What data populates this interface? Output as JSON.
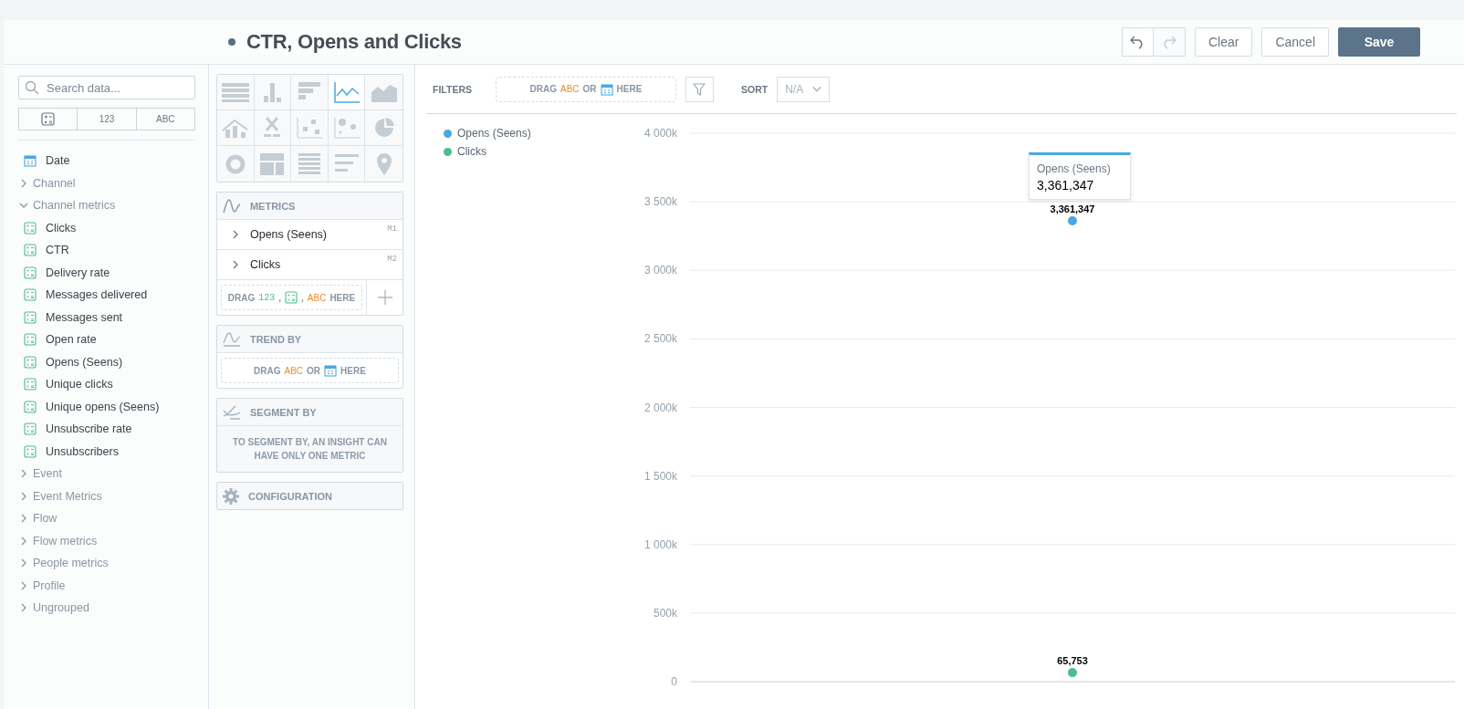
{
  "header": {
    "title": "CTR, Opens and Clicks",
    "undo": {
      "disabled": false
    },
    "redo": {
      "disabled": true
    },
    "buttons": [
      {
        "label": "Clear",
        "kind": "secondary"
      },
      {
        "label": "Cancel",
        "kind": "secondary"
      },
      {
        "label": "Save",
        "kind": "primary"
      }
    ]
  },
  "sidebar": {
    "search": {
      "placeholder": "Search data..."
    },
    "type_filters": [
      {
        "kind": "icon"
      },
      {
        "kind": "text",
        "label": "123"
      },
      {
        "kind": "text",
        "label": "ABC"
      }
    ],
    "items": [
      {
        "kind": "date",
        "label": "Date"
      },
      {
        "kind": "group",
        "label": "Channel",
        "expanded": false
      },
      {
        "kind": "group",
        "label": "Channel metrics",
        "expanded": true,
        "children": [
          {
            "kind": "metric",
            "label": "Clicks"
          },
          {
            "kind": "metric",
            "label": "CTR"
          },
          {
            "kind": "metric",
            "label": "Delivery rate"
          },
          {
            "kind": "metric",
            "label": "Messages delivered"
          },
          {
            "kind": "metric",
            "label": "Messages sent"
          },
          {
            "kind": "metric",
            "label": "Open rate"
          },
          {
            "kind": "metric",
            "label": "Opens (Seens)"
          },
          {
            "kind": "metric",
            "label": "Unique clicks"
          },
          {
            "kind": "metric",
            "label": "Unique opens (Seens)"
          },
          {
            "kind": "metric",
            "label": "Unsubscribe rate"
          },
          {
            "kind": "metric",
            "label": "Unsubscribers"
          }
        ]
      },
      {
        "kind": "group",
        "label": "Event",
        "expanded": false
      },
      {
        "kind": "group",
        "label": "Event Metrics",
        "expanded": false
      },
      {
        "kind": "group",
        "label": "Flow",
        "expanded": false
      },
      {
        "kind": "group",
        "label": "Flow metrics",
        "expanded": false
      },
      {
        "kind": "group",
        "label": "People metrics",
        "expanded": false
      },
      {
        "kind": "group",
        "label": "Profile",
        "expanded": false
      },
      {
        "kind": "group",
        "label": "Ungrouped",
        "expanded": false
      }
    ]
  },
  "chart_types": [
    {
      "kind": "table",
      "selected": false
    },
    {
      "kind": "column",
      "selected": false
    },
    {
      "kind": "bar",
      "selected": false
    },
    {
      "kind": "line",
      "selected": true
    },
    {
      "kind": "area",
      "selected": false
    },
    {
      "kind": "combo",
      "selected": false
    },
    {
      "kind": "headline",
      "selected": false
    },
    {
      "kind": "scatter",
      "selected": false
    },
    {
      "kind": "bubble",
      "selected": false
    },
    {
      "kind": "pie",
      "selected": false
    },
    {
      "kind": "donut",
      "selected": false
    },
    {
      "kind": "treemap",
      "selected": false
    },
    {
      "kind": "heatmap",
      "selected": false
    },
    {
      "kind": "bullet",
      "selected": false
    },
    {
      "kind": "geo",
      "selected": false
    }
  ],
  "metrics": {
    "title": "METRICS",
    "items": [
      {
        "label": "Opens (Seens)",
        "tag": "M1"
      },
      {
        "label": "Clicks",
        "tag": "M2"
      }
    ],
    "drop_zone": [
      "DRAG",
      "123",
      ",",
      ",",
      "ABC",
      "HERE"
    ]
  },
  "trend_by": {
    "title": "TREND BY",
    "drop_zone": [
      "DRAG",
      "ABC",
      "OR",
      "HERE"
    ]
  },
  "segment_by": {
    "title": "SEGMENT BY",
    "message": "TO SEGMENT BY, AN INSIGHT CAN HAVE ONLY ONE METRIC"
  },
  "configuration": {
    "title": "CONFIGURATION"
  },
  "filters": {
    "label": "FILTERS",
    "drop_zone": [
      "DRAG",
      "ABC",
      "OR",
      "HERE"
    ]
  },
  "sort": {
    "label": "SORT",
    "value": "N/A"
  },
  "chart": {
    "chart_data": {
      "type": "line",
      "grid": true,
      "ylim": [
        0,
        4000000
      ],
      "yticks": [
        {
          "value": 0,
          "label": "0"
        },
        {
          "value": 500000,
          "label": "500k"
        },
        {
          "value": 1000000,
          "label": "1 000k"
        },
        {
          "value": 1500000,
          "label": "1 500k"
        },
        {
          "value": 2000000,
          "label": "2 000k"
        },
        {
          "value": 2500000,
          "label": "2 500k"
        },
        {
          "value": 3000000,
          "label": "3 000k"
        },
        {
          "value": 3500000,
          "label": "3 500k"
        },
        {
          "value": 4000000,
          "label": "4 000k"
        }
      ],
      "series": [
        {
          "name": "Opens (Seens)",
          "color": "#4aa8e0",
          "values": [
            3361347
          ],
          "marker": true
        },
        {
          "name": "Clicks",
          "color": "#4cbd8c",
          "values": [
            65753
          ],
          "marker": true
        }
      ],
      "value_labels": [
        "3,361,347",
        "65,753"
      ]
    },
    "tooltip": {
      "title": "Opens (Seens)",
      "value": "3,361,347"
    }
  }
}
